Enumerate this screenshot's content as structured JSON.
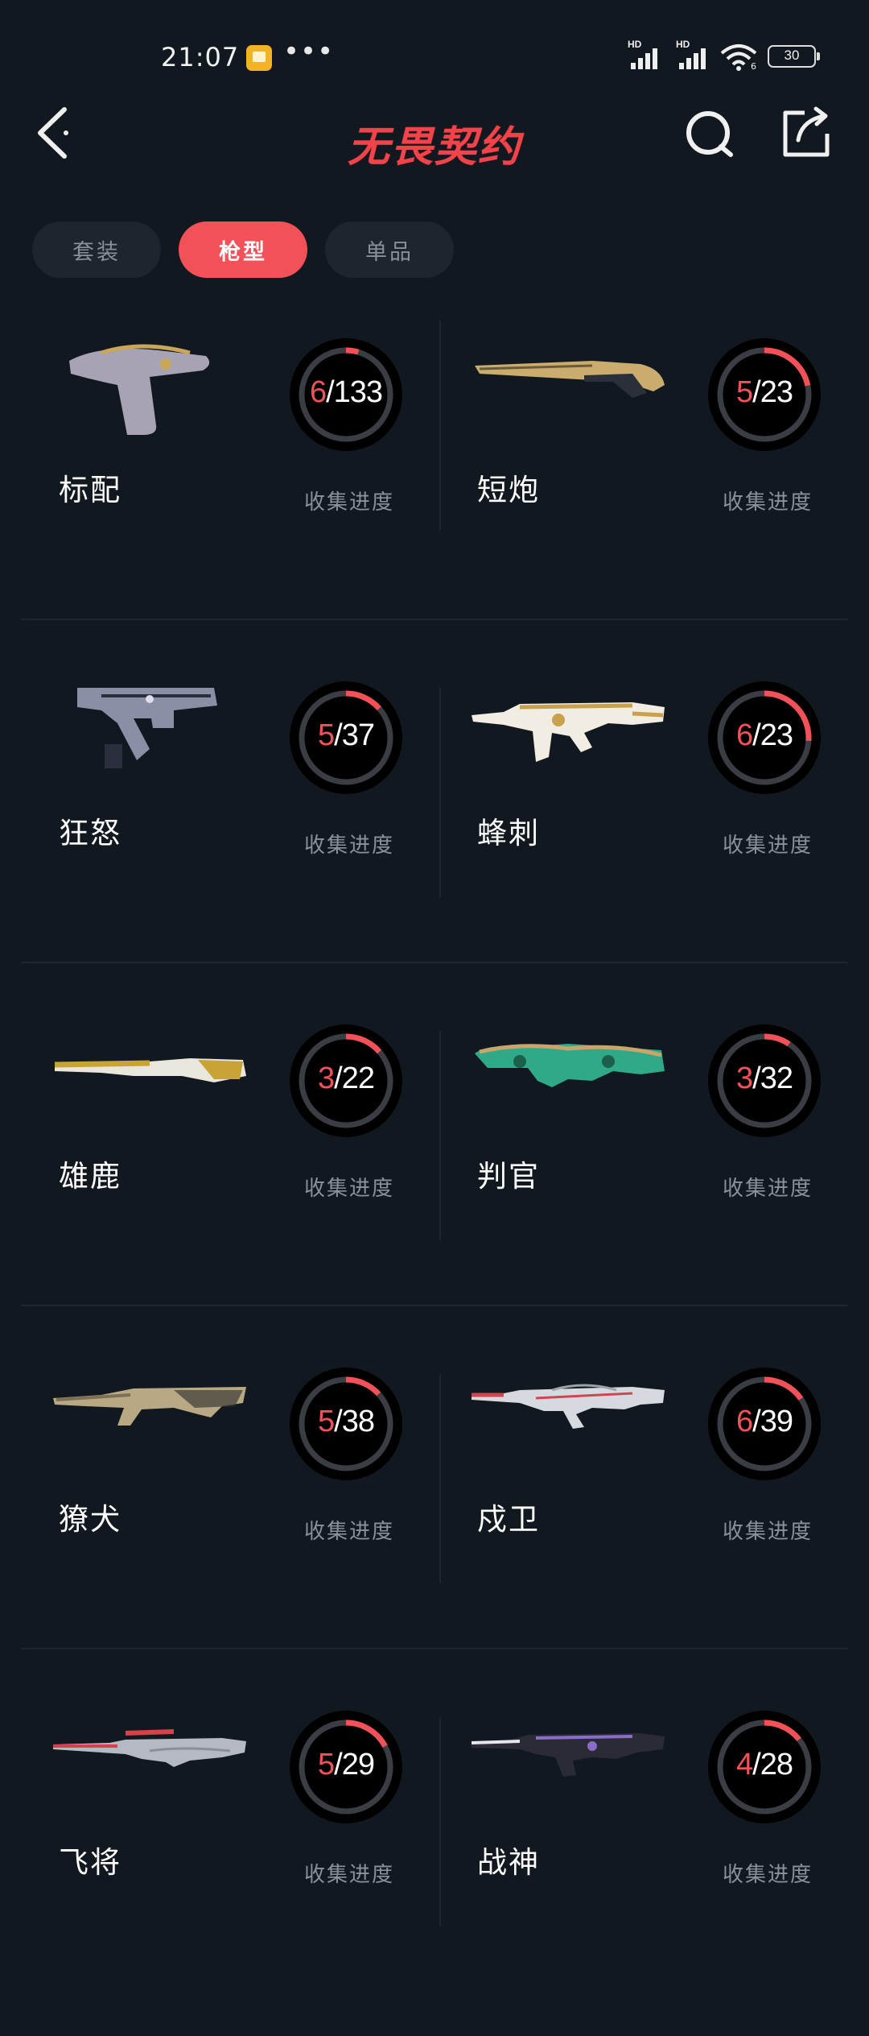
{
  "status_bar": {
    "time": "21:07",
    "more": "•••",
    "signal_1_label": "HD",
    "signal_2_label": "HD",
    "wifi_sub": "6",
    "battery": "30"
  },
  "header": {
    "title": "无畏契约",
    "back_icon": "chevron-left-icon",
    "search_icon": "search-icon",
    "share_icon": "share-icon"
  },
  "tabs": [
    {
      "label": "套装",
      "active": false
    },
    {
      "label": "枪型",
      "active": true
    },
    {
      "label": "单品",
      "active": false
    }
  ],
  "accent": "#f25157",
  "progress_label": "收集进度",
  "weapons": [
    {
      "name": "标配",
      "have": "6",
      "total": "133",
      "fraction": 0.045,
      "body": "#a8a3b4",
      "trim": "#c9a658",
      "shape": "pistol"
    },
    {
      "name": "短炮",
      "have": "5",
      "total": "23",
      "fraction": 0.217,
      "body": "#c9ac6e",
      "trim": "#2a2f3a",
      "shape": "shotgun"
    },
    {
      "name": "狂怒",
      "have": "5",
      "total": "37",
      "fraction": 0.135,
      "body": "#8a8fa6",
      "trim": "#2b2e3c",
      "shape": "smg"
    },
    {
      "name": "蜂刺",
      "have": "6",
      "total": "23",
      "fraction": 0.261,
      "body": "#f1ede2",
      "trim": "#c9a04c",
      "shape": "rifle"
    },
    {
      "name": "雄鹿",
      "have": "3",
      "total": "22",
      "fraction": 0.136,
      "body": "#e9e6dc",
      "trim": "#c8a336",
      "shape": "shotgun2"
    },
    {
      "name": "判官",
      "have": "3",
      "total": "32",
      "fraction": 0.094,
      "body": "#2fa987",
      "trim": "#c9a56a",
      "shape": "heavy"
    },
    {
      "name": "獠犬",
      "have": "5",
      "total": "38",
      "fraction": 0.132,
      "body": "#b8a883",
      "trim": "#3b3a35",
      "shape": "rifle2"
    },
    {
      "name": "戍卫",
      "have": "6",
      "total": "39",
      "fraction": 0.154,
      "body": "#d7d9e0",
      "trim": "#d2454e",
      "shape": "rifle3"
    },
    {
      "name": "飞将",
      "have": "5",
      "total": "29",
      "fraction": 0.172,
      "body": "#c8cbd6",
      "trim": "#d7424a",
      "shape": "sniper"
    },
    {
      "name": "战神",
      "have": "4",
      "total": "28",
      "fraction": 0.143,
      "body": "#2a2b35",
      "trim": "#8a6cc9",
      "shape": "rifle4"
    }
  ]
}
